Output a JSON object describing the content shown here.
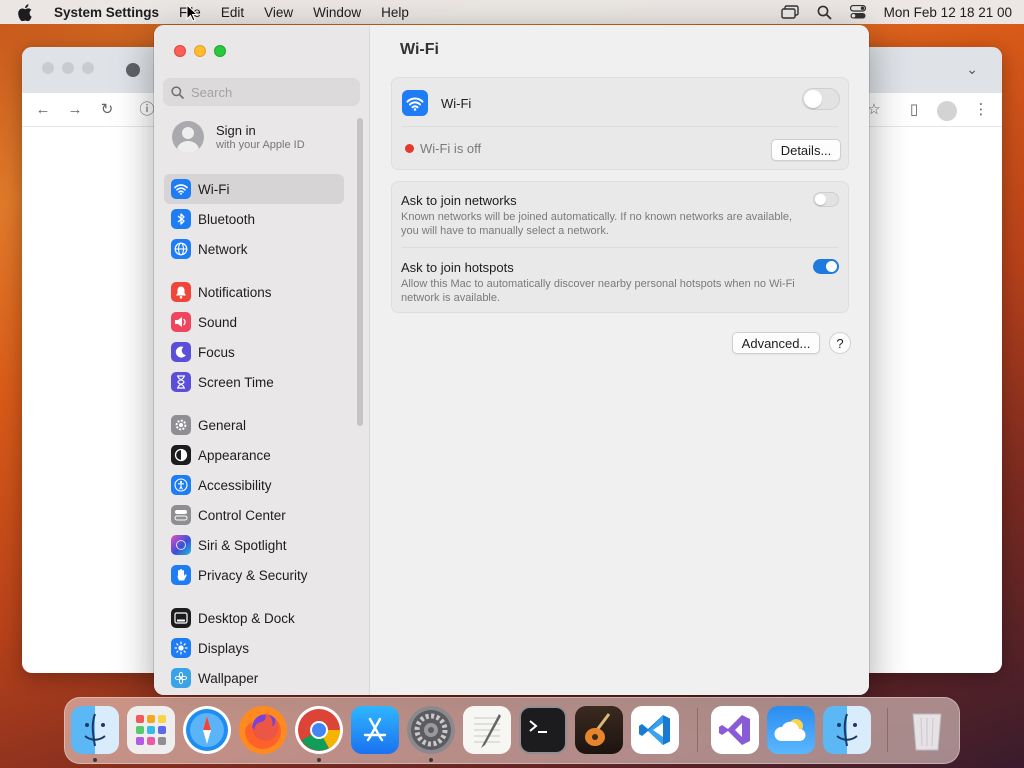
{
  "menubar": {
    "app_name": "System Settings",
    "items": [
      "File",
      "Edit",
      "View",
      "Window",
      "Help"
    ],
    "clock": "Mon Feb 12  18 21 00"
  },
  "sidebar": {
    "search_placeholder": "Search",
    "signin_title": "Sign in",
    "signin_subtitle": "with your Apple ID",
    "items": [
      {
        "label": "Wi-Fi",
        "icon": "wifi-icon",
        "color": "#1e7cf5",
        "selected": true
      },
      {
        "label": "Bluetooth",
        "icon": "bluetooth-icon",
        "color": "#1e7cf5"
      },
      {
        "label": "Network",
        "icon": "globe-icon",
        "color": "#1e7cf5"
      },
      {
        "label": "Notifications",
        "icon": "bell-icon",
        "color": "#f0453a"
      },
      {
        "label": "Sound",
        "icon": "speaker-icon",
        "color": "#f0455f"
      },
      {
        "label": "Focus",
        "icon": "moon-icon",
        "color": "#5b4fd9"
      },
      {
        "label": "Screen Time",
        "icon": "hourglass-icon",
        "color": "#5b4fd9"
      },
      {
        "label": "General",
        "icon": "gear-icon",
        "color": "#8e8e93"
      },
      {
        "label": "Appearance",
        "icon": "appearance-icon",
        "color": "#1c1c1e"
      },
      {
        "label": "Accessibility",
        "icon": "accessibility-icon",
        "color": "#1e7cf5"
      },
      {
        "label": "Control Center",
        "icon": "switches-icon",
        "color": "#8e8e93"
      },
      {
        "label": "Siri & Spotlight",
        "icon": "siri-icon",
        "color": "#7d3bd6"
      },
      {
        "label": "Privacy & Security",
        "icon": "hand-icon",
        "color": "#1e7cf5"
      },
      {
        "label": "Desktop & Dock",
        "icon": "dock-icon",
        "color": "#1c1c1e"
      },
      {
        "label": "Displays",
        "icon": "sun-icon",
        "color": "#1e7cf5"
      },
      {
        "label": "Wallpaper",
        "icon": "wallpaper-icon",
        "color": "#3aa3e8"
      }
    ]
  },
  "main": {
    "title": "Wi-Fi",
    "wifi_label": "Wi-Fi",
    "wifi_status": "Wi-Fi is off",
    "status_color": "#e5392c",
    "details_button": "Details...",
    "ask_networks_title": "Ask to join networks",
    "ask_networks_desc": "Known networks will be joined automatically. If no known networks are available, you will have to manually select a network.",
    "ask_hotspots_title": "Ask to join hotspots",
    "ask_hotspots_desc": "Allow this Mac to automatically discover nearby personal hotspots when no Wi-Fi network is available.",
    "advanced_button": "Advanced...",
    "help_button": "?",
    "accent_color": "#1f7ae0"
  },
  "dock": {
    "apps": [
      "Finder",
      "Launchpad",
      "Safari",
      "Firefox",
      "Chrome",
      "App Store",
      "System Settings",
      "TextEdit",
      "Terminal",
      "GarageBand",
      "Visual Studio Code",
      "Visual Studio",
      "Weather",
      "Finder Downloads",
      "Trash"
    ]
  }
}
